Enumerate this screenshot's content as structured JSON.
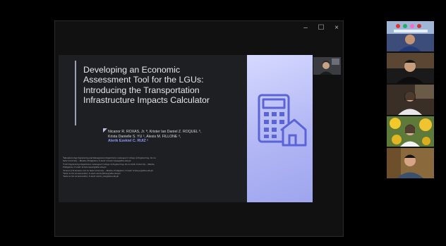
{
  "slide": {
    "title_lines": [
      "Developing an Economic",
      "Assessment Tool for the LGUs:",
      "Introducing the Transportation",
      "Infrastructure Impacts Calculator"
    ],
    "authors_lines": [
      "Nicanor R. ROXAS, Jr. ª, Krister Ian Daniel Z. ROQUEL ᵇ,",
      "Krista Danielle S. YU ᶜ, Alexis M. FILLONE ᵈ,",
      "Alerik Ezekiel C. RUIZ ᵉ"
    ],
    "affiliations_lines": [
      "ªManufacturing Engineering and Management Department, Gokongwei College of Engineering, De La",
      "Salle University – Manila, Philippines; E-mail: nicanor.roxas@dlsu.edu.ph",
      "ᵇCivil Engineering Department, Gokongwei College of Engineering, De La Salle University – Manila,",
      "Philippines; E-mail: krister.roquel@dlsu.edu.ph",
      "ᶜSchool of Economics, De La Salle University – Manila, Philippines; E-mail: krista.yu@dlsu.edu.ph",
      "ᵈSame as the second author; E-mail: alexis.fillone@dlsu.edu.ph",
      "ᵉSame as the second author; E-mail: alerik_ruiz@dlsu.edu.ph"
    ]
  },
  "window_controls": {
    "minimize": "–",
    "maximize": "☐",
    "close": "×"
  },
  "icons": {
    "calculator": "calculator-house-icon"
  },
  "colors": {
    "slide_bg": "#1d1f22",
    "panel": "#b2b7f4",
    "icon": "#5b63d8",
    "author_highlight": "#8f9bff"
  }
}
